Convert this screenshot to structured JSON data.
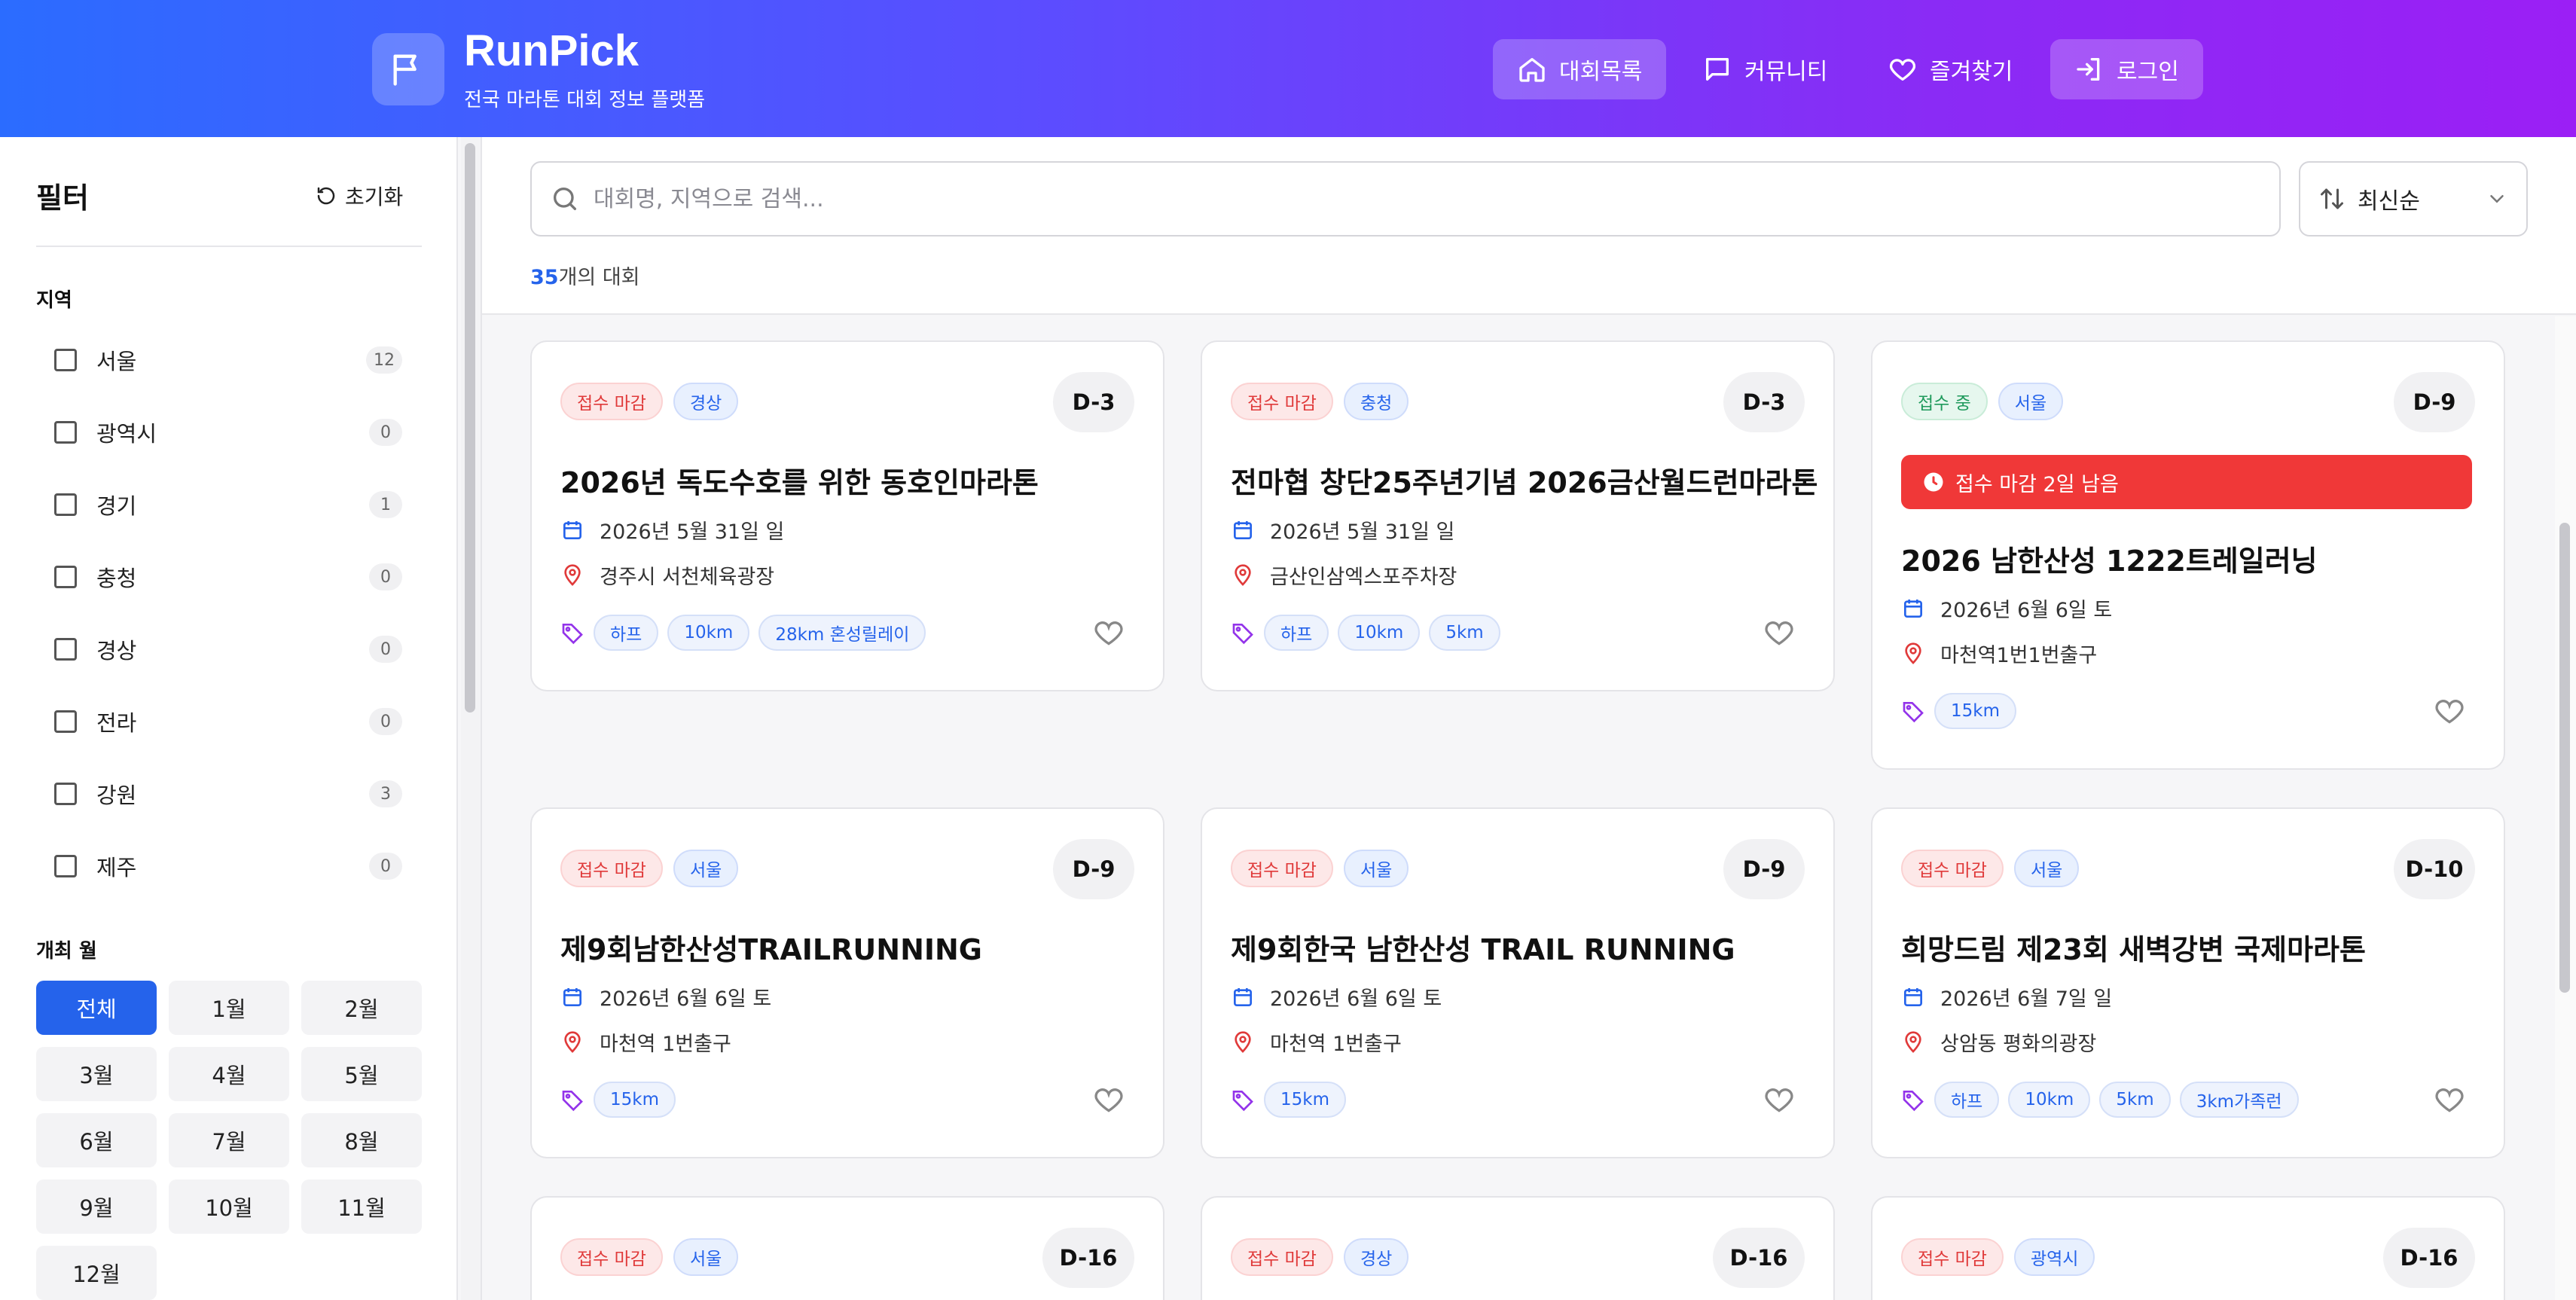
{
  "header": {
    "brand": "RunPick",
    "tagline": "전국 마라톤 대회 정보 플랫폼",
    "nav": [
      {
        "label": "대회목록",
        "icon": "home-icon",
        "active": true
      },
      {
        "label": "커뮤니티",
        "icon": "chat-icon",
        "active": false
      },
      {
        "label": "즐겨찾기",
        "icon": "heart-icon",
        "active": false
      },
      {
        "label": "로그인",
        "icon": "login-icon",
        "active": true
      }
    ]
  },
  "sidebar": {
    "title": "필터",
    "reset_label": "초기화",
    "region_label": "지역",
    "regions": [
      {
        "name": "서울",
        "count": "12"
      },
      {
        "name": "광역시",
        "count": "0"
      },
      {
        "name": "경기",
        "count": "1"
      },
      {
        "name": "충청",
        "count": "0"
      },
      {
        "name": "경상",
        "count": "0"
      },
      {
        "name": "전라",
        "count": "0"
      },
      {
        "name": "강원",
        "count": "3"
      },
      {
        "name": "제주",
        "count": "0"
      }
    ],
    "month_label": "개최 월",
    "months": [
      "전체",
      "1월",
      "2월",
      "3월",
      "4월",
      "5월",
      "6월",
      "7월",
      "8월",
      "9월",
      "10월",
      "11월",
      "12월"
    ],
    "active_month": "전체"
  },
  "search": {
    "placeholder": "대회명, 지역으로 검색...",
    "sort_label": "최신순",
    "result_count": "35",
    "result_suffix": "개의 대회"
  },
  "colors": {
    "primary": "#2563eb",
    "closed": "#e03a3a",
    "open": "#1f9a5c",
    "alert": "#f03838"
  },
  "cards": [
    {
      "status": "접수 마감",
      "region": "경상",
      "dday": "D-3",
      "title": "2026년 독도수호를 위한 동호인마라톤",
      "date": "2026년 5월 31일 일",
      "location": "경주시 서천체육광장",
      "tags": [
        "하프",
        "10km",
        "28km 혼성릴레이"
      ]
    },
    {
      "status": "접수 마감",
      "region": "충청",
      "dday": "D-3",
      "title": "전마협 창단25주년기념 2026금산월드런마라톤",
      "date": "2026년 5월 31일 일",
      "location": "금산인삼엑스포주차장",
      "tags": [
        "하프",
        "10km",
        "5km"
      ]
    },
    {
      "status": "접수 중",
      "region": "서울",
      "dday": "D-9",
      "alert": "접수 마감 2일 남음",
      "title": "2026 남한산성 1222트레일러닝",
      "date": "2026년 6월 6일 토",
      "location": "마천역1번1번출구",
      "tags": [
        "15km"
      ]
    },
    {
      "status": "접수 마감",
      "region": "서울",
      "dday": "D-9",
      "title": "제9회남한산성TRAILRUNNING",
      "date": "2026년 6월 6일 토",
      "location": "마천역 1번출구",
      "tags": [
        "15km"
      ]
    },
    {
      "status": "접수 마감",
      "region": "서울",
      "dday": "D-9",
      "title": "제9회한국 남한산성 TRAIL RUNNING",
      "date": "2026년 6월 6일 토",
      "location": "마천역 1번출구",
      "tags": [
        "15km"
      ]
    },
    {
      "status": "접수 마감",
      "region": "서울",
      "dday": "D-10",
      "title": "희망드림 제23회 새벽강변 국제마라톤",
      "date": "2026년 6월 7일 일",
      "location": "상암동 평화의광장",
      "tags": [
        "하프",
        "10km",
        "5km",
        "3km가족런"
      ]
    },
    {
      "status": "접수 마감",
      "region": "서울",
      "dday": "D-16"
    },
    {
      "status": "접수 마감",
      "region": "경상",
      "dday": "D-16"
    },
    {
      "status": "접수 마감",
      "region": "광역시",
      "dday": "D-16"
    }
  ]
}
